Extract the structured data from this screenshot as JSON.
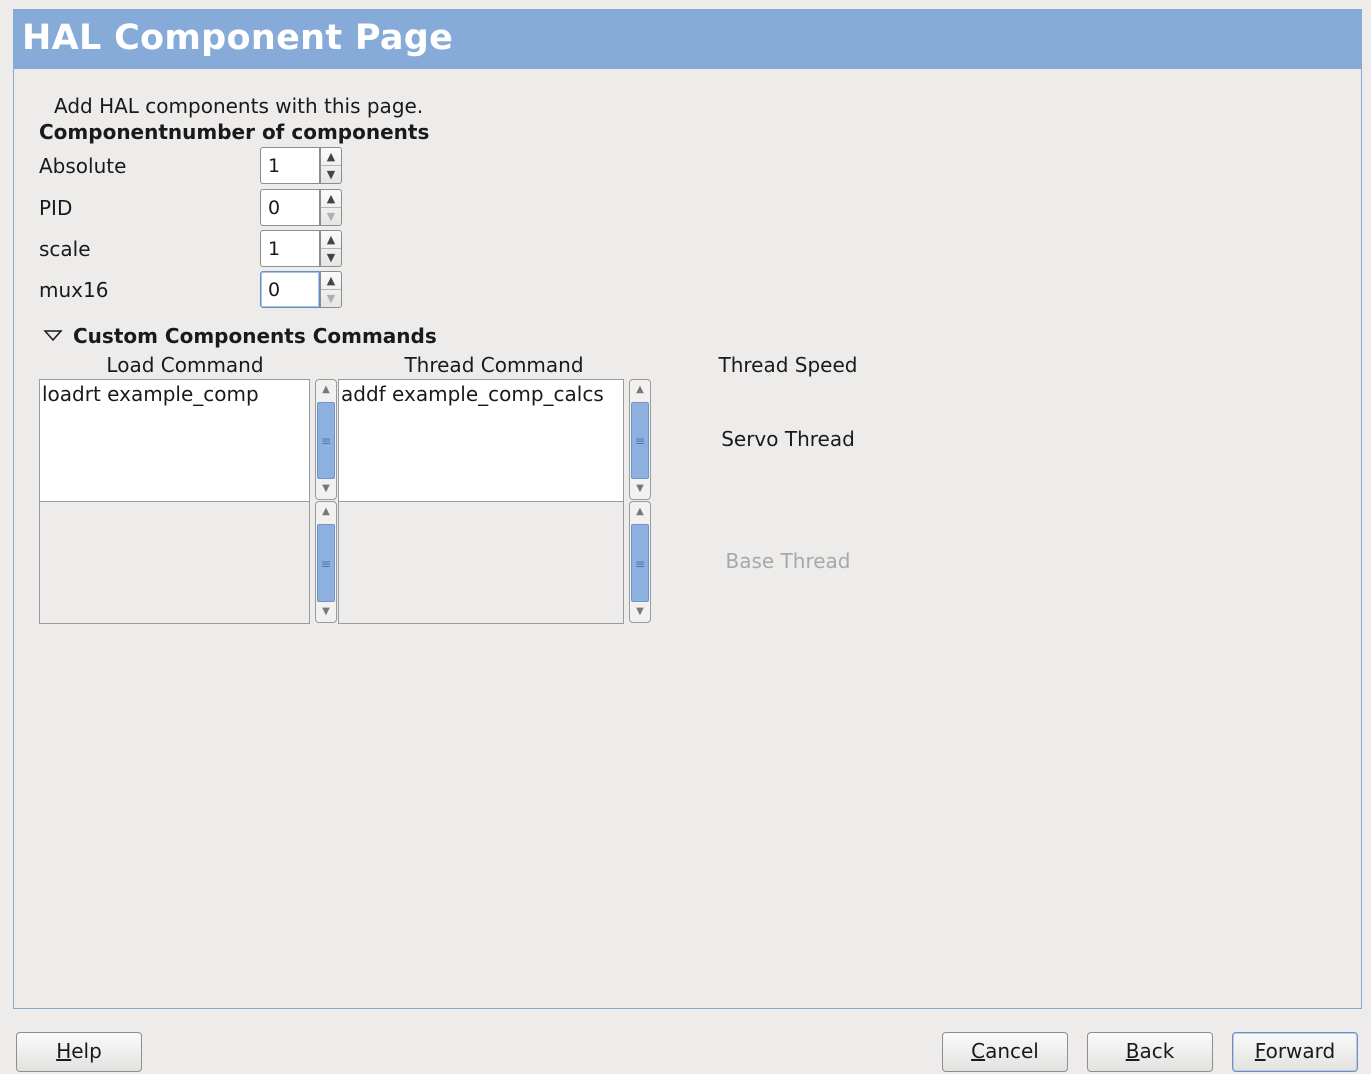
{
  "page": {
    "title": "HAL Component Page",
    "description": "Add HAL components with this page.",
    "column_header": "Componentnumber of components"
  },
  "components": [
    {
      "label": "Absolute",
      "value": "1"
    },
    {
      "label": "PID",
      "value": "0"
    },
    {
      "label": "scale",
      "value": "1"
    },
    {
      "label": "mux16",
      "value": "0"
    }
  ],
  "custom": {
    "expander_label": "Custom Components Commands",
    "load_header": "Load Command",
    "thread_header": "Thread Command",
    "speed_header": "Thread Speed",
    "servo_load_text": "loadrt example_comp",
    "servo_thread_text": "addf example_comp_calcs",
    "servo_label": "Servo Thread",
    "base_load_text": "",
    "base_thread_text": "",
    "base_label": "Base Thread"
  },
  "buttons": {
    "help": {
      "mnemonic": "H",
      "rest": "elp"
    },
    "cancel": {
      "mnemonic": "C",
      "rest": "ancel"
    },
    "back": {
      "mnemonic": "B",
      "rest": "ack"
    },
    "forward": {
      "mnemonic": "F",
      "rest": "orward"
    }
  },
  "colors": {
    "header_bg": "#87abd9",
    "window_bg": "#edeceb",
    "scroll_thumb": "#8db0df"
  }
}
